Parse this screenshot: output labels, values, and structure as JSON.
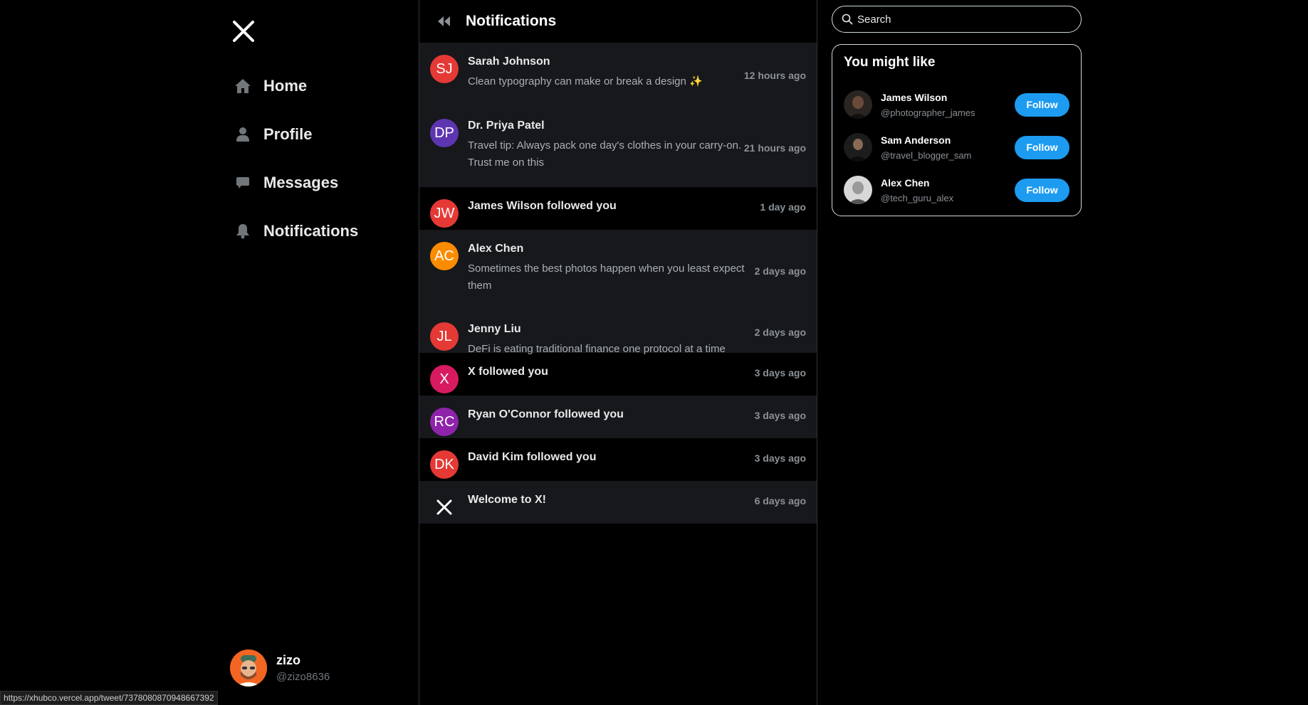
{
  "sidebar": {
    "logo_icon": "x-logo-icon",
    "nav": [
      {
        "label": "Home",
        "icon": "home-icon"
      },
      {
        "label": "Profile",
        "icon": "person-icon"
      },
      {
        "label": "Messages",
        "icon": "message-icon"
      },
      {
        "label": "Notifications",
        "icon": "bell-icon"
      }
    ],
    "account": {
      "name": "zizo",
      "handle": "@zizo8636"
    }
  },
  "status_bar": {
    "url": "https://xhubco.vercel.app/tweet/7378080870948667392"
  },
  "main": {
    "title": "Notifications",
    "notifications": [
      {
        "initials": "SJ",
        "color": "#e53935",
        "name": "Sarah Johnson",
        "text": "Clean typography can make or break a design ✨",
        "time": "12 hours ago"
      },
      {
        "initials": "DP",
        "color": "#5e35b1",
        "name": "Dr. Priya Patel",
        "text": "Travel tip: Always pack one day's clothes in your carry-on. Trust me on this",
        "time": "21 hours ago"
      },
      {
        "initials": "JW",
        "color": "#e53935",
        "name": "James Wilson followed you",
        "text": "",
        "time": "1 day ago"
      },
      {
        "initials": "AC",
        "color": "#fb8c00",
        "name": "Alex Chen",
        "text": "Sometimes the best photos happen when you least expect them",
        "time": "2 days ago"
      },
      {
        "initials": "JL",
        "color": "#e53935",
        "name": "Jenny Liu",
        "text": "DeFi is eating traditional finance one protocol at a time",
        "time": "2 days ago"
      },
      {
        "initials": "X",
        "color": "#d81b60",
        "name": "X followed you",
        "text": "",
        "time": "3 days ago"
      },
      {
        "initials": "RC",
        "color": "#8e24aa",
        "name": "Ryan O'Connor followed you",
        "text": "",
        "time": "3 days ago"
      },
      {
        "initials": "DK",
        "color": "#e53935",
        "name": "David Kim followed you",
        "text": "",
        "time": "3 days ago"
      },
      {
        "initials": "",
        "color": "",
        "name": "Welcome to X!",
        "text": "",
        "time": "6 days ago"
      }
    ]
  },
  "right": {
    "search_placeholder": "Search",
    "suggestions_title": "You might like",
    "suggestions": [
      {
        "name": "James Wilson",
        "handle": "@photographer_james",
        "button": "Follow"
      },
      {
        "name": "Sam Anderson",
        "handle": "@travel_blogger_sam",
        "button": "Follow"
      },
      {
        "name": "Alex Chen",
        "handle": "@tech_guru_alex",
        "button": "Follow"
      }
    ]
  },
  "colors": {
    "accent": "#1d9bf0",
    "background": "#000000",
    "row_alt": "#16181c"
  }
}
